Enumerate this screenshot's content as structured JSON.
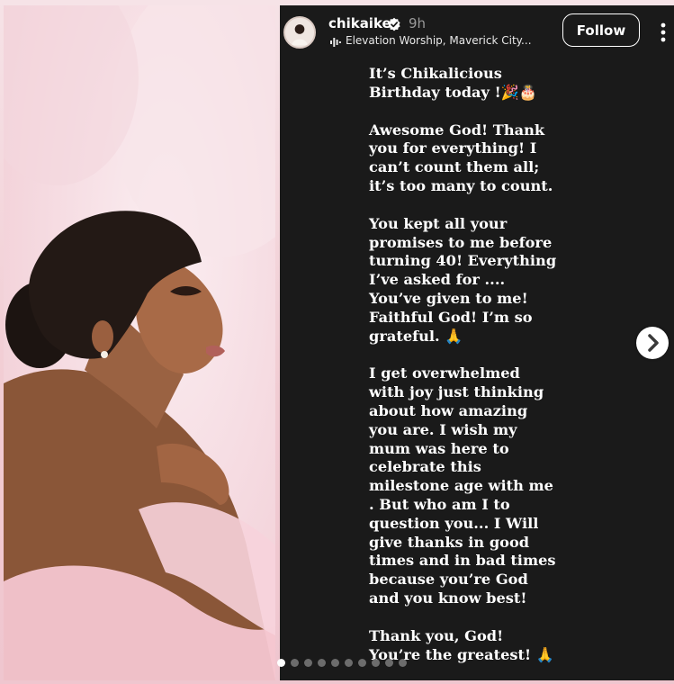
{
  "post": {
    "username": "chikaike",
    "time": "9h",
    "music": "Elevation Worship, Maverick City...",
    "follow_label": "Follow"
  },
  "caption": [
    "It’s Chikalicious Birthday today !🎉🎂",
    "Awesome God!  Thank you for everything! I can’t count them all; it’s too many to count.",
    "You kept all your promises to me before turning 40! Everything I’ve asked for .... You’ve given to me! Faithful God! I’m so grateful. 🙏",
    "I get overwhelmed with joy just thinking about how amazing you are. I wish my mum was here to celebrate this milestone age with me . But who am I to question you... I Will give thanks in good times and in bad times because you’re God and you know best!",
    "Thank you, God! You’re the greatest! 🙏"
  ],
  "carousel": {
    "slides": 10,
    "active_index": 0
  },
  "colors": {
    "background": "#f3d6dc",
    "story_bg": "#1a1a1a",
    "text": "#ffffff"
  },
  "icons": {
    "verified": "verified-badge-icon",
    "music": "music-bars-icon",
    "more": "more-vertical-icon",
    "next": "chevron-right-icon"
  }
}
